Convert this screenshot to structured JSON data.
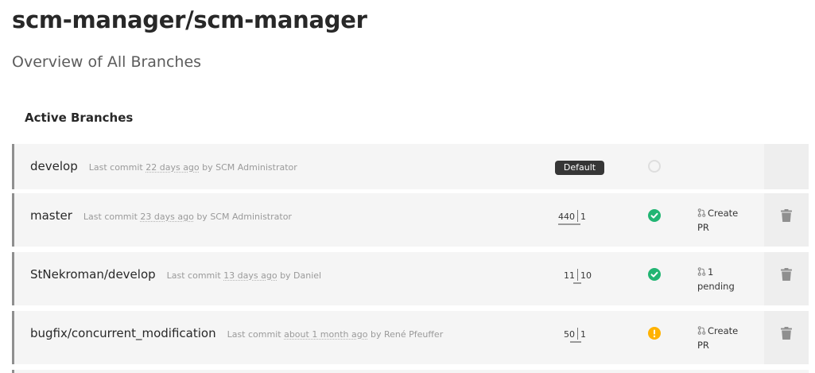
{
  "header": {
    "title": "scm-manager/scm-manager",
    "subtitle": "Overview of All Branches",
    "section": "Active Branches"
  },
  "branches": [
    {
      "name": "develop",
      "meta_prefix": "Last commit",
      "meta_time": "22 days ago",
      "meta_suffix": "by SCM Administrator",
      "default_tag": "Default",
      "status": "pending"
    },
    {
      "name": "master",
      "meta_prefix": "Last commit",
      "meta_time": "23 days ago",
      "meta_suffix": "by SCM Administrator",
      "behind": "440",
      "ahead": "1",
      "status": "ok",
      "pr_line1": "Create",
      "pr_line2": "PR",
      "pr_icon": "git-pull-request-icon",
      "delete_icon": "trash-icon"
    },
    {
      "name": "StNekroman/develop",
      "meta_prefix": "Last commit",
      "meta_time": "13 days ago",
      "meta_suffix": "by Daniel",
      "behind": "11",
      "ahead": "10",
      "status": "ok",
      "pr_line1": "1",
      "pr_line2": "pending",
      "pr_icon": "git-pull-request-icon",
      "delete_icon": "trash-icon"
    },
    {
      "name": "bugfix/concurrent_modification",
      "meta_prefix": "Last commit",
      "meta_time": "about 1 month ago",
      "meta_suffix": "by René Pfeuffer",
      "behind": "50",
      "ahead": "1",
      "status": "warn",
      "pr_line1": "Create",
      "pr_line2": "PR",
      "pr_icon": "git-pull-request-icon",
      "delete_icon": "trash-icon"
    }
  ],
  "colors": {
    "success": "#22b573",
    "warning": "#ffb200",
    "row_bg": "#f5f5f5",
    "row_border": "#8f8f8f"
  }
}
